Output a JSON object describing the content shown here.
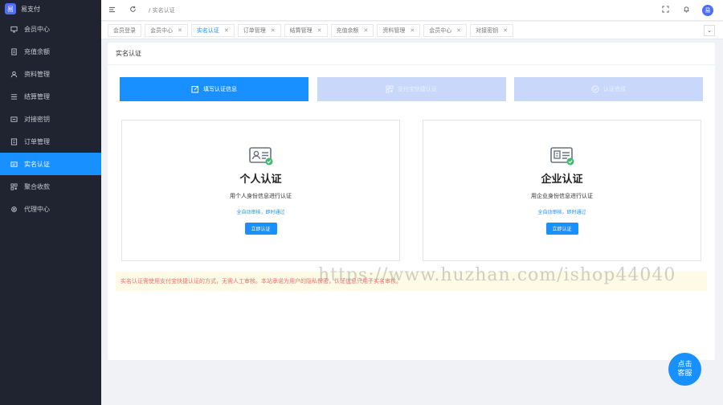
{
  "brand": {
    "logo_text": "易",
    "name": "易支付"
  },
  "sidebar": {
    "items": [
      {
        "label": "会员中心",
        "icon": "monitor-icon",
        "active": false
      },
      {
        "label": "充值余额",
        "icon": "document-icon",
        "active": false
      },
      {
        "label": "资料管理",
        "icon": "user-icon",
        "active": false
      },
      {
        "label": "结算管理",
        "icon": "list-icon",
        "active": false
      },
      {
        "label": "对接密钥",
        "icon": "key-icon",
        "active": false
      },
      {
        "label": "订单管理",
        "icon": "order-icon",
        "active": false
      },
      {
        "label": "实名认证",
        "icon": "id-card-icon",
        "active": true
      },
      {
        "label": "聚合收款",
        "icon": "qrcode-icon",
        "active": false
      },
      {
        "label": "代理中心",
        "icon": "gear-icon",
        "active": false
      }
    ]
  },
  "header": {
    "breadcrumb": "/ 实名认证",
    "avatar_text": "易"
  },
  "tabs": [
    {
      "label": "会员登录",
      "closable": false,
      "active": false
    },
    {
      "label": "会员中心",
      "closable": true,
      "active": false
    },
    {
      "label": "实名认证",
      "closable": true,
      "active": true
    },
    {
      "label": "订单管理",
      "closable": true,
      "active": false
    },
    {
      "label": "结算管理",
      "closable": true,
      "active": false
    },
    {
      "label": "充值余额",
      "closable": true,
      "active": false
    },
    {
      "label": "资料管理",
      "closable": true,
      "active": false
    },
    {
      "label": "会员中心",
      "closable": true,
      "active": false
    },
    {
      "label": "对接密钥",
      "closable": true,
      "active": false
    }
  ],
  "card": {
    "title": "实名认证"
  },
  "steps": [
    {
      "label": "填写认证信息",
      "icon": "edit-icon"
    },
    {
      "label": "支付宝快捷认证",
      "icon": "qrcode-icon"
    },
    {
      "label": "认证完成",
      "icon": "check-circle-icon"
    }
  ],
  "panels": {
    "personal": {
      "title": "个人认证",
      "desc": "用个人身份信息进行认证",
      "tag": "全自动审核，即时通过",
      "button": "立即认证"
    },
    "company": {
      "title": "企业认证",
      "desc": "用企业身份信息进行认证",
      "tag": "全自动审核，即时通过",
      "button": "立即认证"
    }
  },
  "notice": "实名认证需使用支付宝快捷认证的方式，无需人工审核。本站承诺为用户的隐私保密，认证信息只用于实名审核。",
  "watermark": "https://www.huzhan.com/ishop44040",
  "service": {
    "line1": "点击",
    "line2": "客服"
  },
  "colors": {
    "primary": "#1890ff",
    "sidebar_bg": "#1f2430",
    "step_disabled": "#c9d7fb",
    "notice_bg": "#fdfbe5",
    "notice_text": "#f56c6c",
    "check_green": "#3dba6b"
  }
}
